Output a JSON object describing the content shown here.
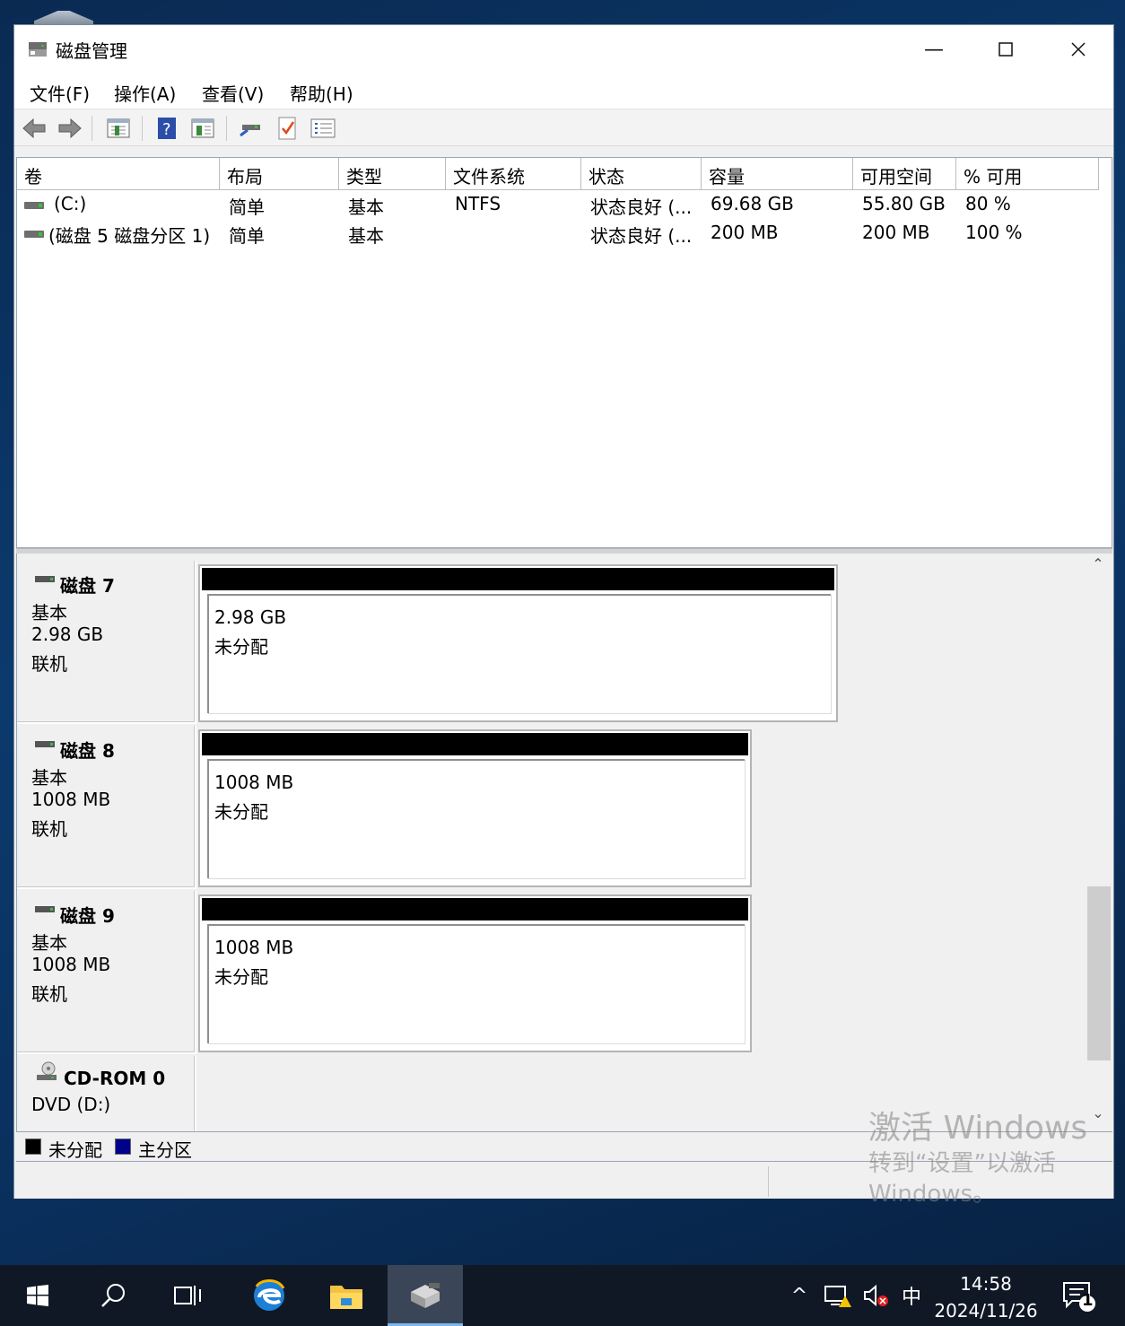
{
  "window": {
    "title": "磁盘管理"
  },
  "menu": [
    "文件(F)",
    "操作(A)",
    "查看(V)",
    "帮助(H)"
  ],
  "toolbar": [
    "back-icon",
    "forward-icon",
    "properties-icon",
    "help-icon",
    "show-hide-icon",
    "connect-icon",
    "check-icon",
    "list-icon"
  ],
  "columns": [
    "卷",
    "布局",
    "类型",
    "文件系统",
    "状态",
    "容量",
    "可用空间",
    "% 可用"
  ],
  "volumes": [
    {
      "name": "(C:)",
      "layout": "简单",
      "type": "基本",
      "fs": "NTFS",
      "status": "状态良好 (...",
      "capacity": "69.68 GB",
      "free": "55.80 GB",
      "pct": "80 %"
    },
    {
      "name": "(磁盘 5 磁盘分区 1)",
      "layout": "简单",
      "type": "基本",
      "fs": "",
      "status": "状态良好 (...",
      "capacity": "200 MB",
      "free": "200 MB",
      "pct": "100 %"
    }
  ],
  "disks": [
    {
      "name": "磁盘 7",
      "type": "基本",
      "size": "2.98 GB",
      "state": "联机",
      "part_size": "2.98 GB",
      "part_state": "未分配"
    },
    {
      "name": "磁盘 8",
      "type": "基本",
      "size": "1008 MB",
      "state": "联机",
      "part_size": "1008 MB",
      "part_state": "未分配"
    },
    {
      "name": "磁盘 9",
      "type": "基本",
      "size": "1008 MB",
      "state": "联机",
      "part_size": "1008 MB",
      "part_state": "未分配"
    }
  ],
  "cdrom": {
    "name": "CD-ROM 0",
    "drive": "DVD (D:)"
  },
  "legend": [
    {
      "label": "未分配",
      "color": "#000000"
    },
    {
      "label": "主分区",
      "color": "#00008b"
    }
  ],
  "watermark": {
    "line1": "激活 Windows",
    "line2": "转到“设置”以激活",
    "line3": "Windows。"
  },
  "taskbar": {
    "apps": [
      "start-icon",
      "search-icon",
      "task-view-icon",
      "edge-icon",
      "file-explorer-icon",
      "disk-management-icon"
    ],
    "ime": "中",
    "time": "14:58",
    "date": "2024/11/26",
    "notifications": "1"
  }
}
